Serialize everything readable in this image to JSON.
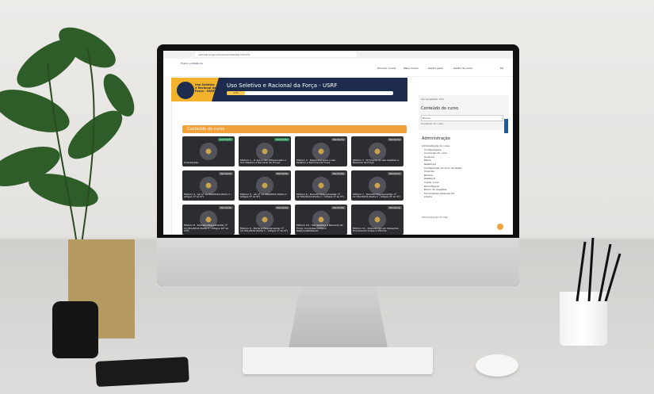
{
  "browser": {
    "url": "ead.sdp.mj.gov.br/course/view.php?id=174"
  },
  "site_nav": {
    "logo_label": "Ensino a Distância",
    "links": [
      "Procurar cursos",
      "Meus cursos",
      "Gestor geral",
      "Gestor de curso"
    ],
    "user_initials": "PU"
  },
  "hero": {
    "course_short": "Uso Seletivo e Racional da Força - USRF",
    "title": "Uso Seletivo e Racional da Força - USRF",
    "progress_label": "11%",
    "progress_fraction": 0.11
  },
  "content": {
    "section_header": "Conteúdo do curso",
    "cards": [
      {
        "title": "Orientações",
        "tag": "Concluído",
        "done": true
      },
      {
        "title": "Módulo 1 - O que é Uso Diferenciado e Uso Seletivo e Racional da Força?",
        "tag": "Concluído",
        "done": true
      },
      {
        "title": "Módulo 2 - Requisitos para o Uso Seletivo e Racional da Força",
        "tag": "Pendente",
        "done": false
      },
      {
        "title": "Módulo 3 - Princípios do Uso Seletivo e Racional da Força",
        "tag": "Pendente",
        "done": false
      },
      {
        "title": "Módulo 4 - Lei nº 13.060/2014 (Parte 1 - Artigos 1º ao 4º)",
        "tag": "Pendente",
        "done": false
      },
      {
        "title": "Módulo 5 - Lei nº 13.060/2014 (Parte 2 - Artigos 5º ao 9º)",
        "tag": "Pendente",
        "done": false
      },
      {
        "title": "Módulo 6 - Decreto Regulamentar nº 12.341/2024 (Parte 1 - Artigos 1º ao 5º)",
        "tag": "Pendente",
        "done": false
      },
      {
        "title": "Módulo 7 - Decreto Regulamentar nº 12.341/2024 (Parte 2 - Artigos 6º ao 9º)",
        "tag": "Pendente",
        "done": false
      },
      {
        "title": "Módulo 8 - Decreto Regulamentar nº 12.341/2024 (Parte 3 - Artigos 10º ao 14º)",
        "tag": "Pendente",
        "done": false
      },
      {
        "title": "Módulo 9 - Portaria Regulamentar nº 12.341/2024 (Parte 1 - Artigos 1º ao 9º)",
        "tag": "Pendente",
        "done": false
      },
      {
        "title": "Módulo 10 - Uso Seletivo e Racional da Força: Condutas Ilícitas e Responsabilização",
        "tag": "Pendente",
        "done": false
      },
      {
        "title": "Módulo 11 - Intervenção em Situações Envolvendo Crises e Vítimas",
        "tag": "Pendente",
        "done": false
      }
    ]
  },
  "right_panel": {
    "progress_text": "Seu progresso 11%",
    "course_content_title": "Conteúdo do curso",
    "search_placeholder": "Buscar",
    "course_item": "Conteúdo do curso",
    "admin_title": "Administração",
    "admin_items": [
      "Administração do curso",
      "Configurações",
      "Conclusão do curso",
      "Usuários",
      "Filtros",
      "Relatórios",
      "Configuração do Livro de Notas",
      "Importar",
      "Backup",
      "Restaurar",
      "Copiar curso",
      "Reconfigurar",
      "Banco de questões",
      "Ferramentas externas LTI",
      "Lixeira"
    ],
    "site_admin": "Administração do site"
  }
}
